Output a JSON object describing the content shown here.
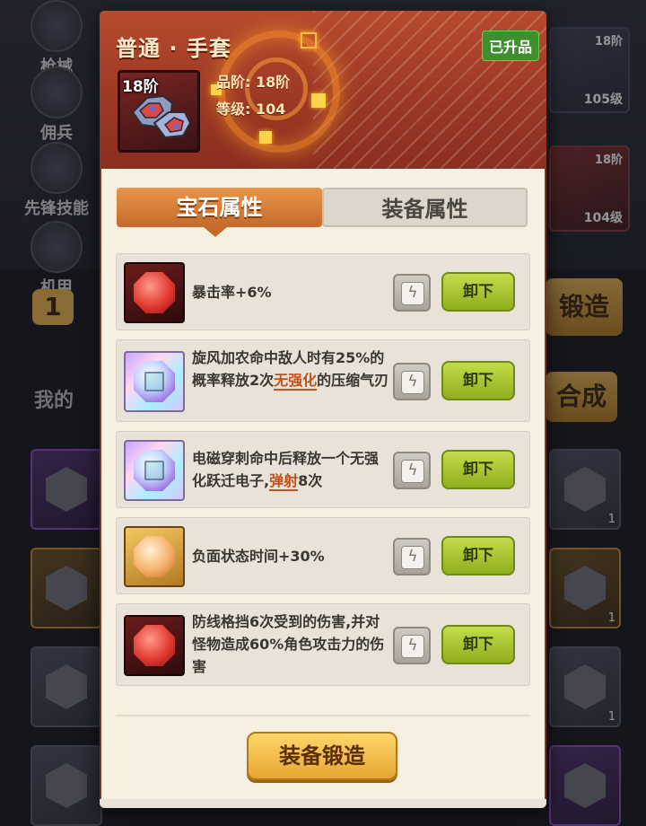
{
  "background": {
    "side_items": [
      "枪械",
      "佣兵",
      "先锋技能",
      "机甲"
    ],
    "card_levels": [
      "105级",
      "104级"
    ],
    "card_stars": [
      "18阶",
      "18阶"
    ],
    "counter": "1",
    "forge_button": "锻造",
    "combine_button": "合成",
    "my_label": "我的",
    "tile_counts": [
      "1",
      "1",
      "1"
    ]
  },
  "header": {
    "title": "普通 · 手套",
    "badge": "已升品",
    "item_level": "18阶",
    "quality": "品阶:  18阶",
    "level": "等级:  104"
  },
  "tabs": {
    "gem": "宝石属性",
    "equip": "装备属性",
    "active": "gem"
  },
  "gems": [
    {
      "color": "red",
      "text": "暴击率+6%",
      "action": "卸下"
    },
    {
      "color": "rainbow",
      "text_before": "旋风加农命中敌人时有25%的概率释放2次",
      "keyword": "无强化",
      "text_after": "的压缩气刃",
      "action": "卸下"
    },
    {
      "color": "rainbow",
      "text_before": "电磁穿刺命中后释放一个无强化跃迁电子,",
      "keyword": "弹射",
      "text_after": "8次",
      "action": "卸下"
    },
    {
      "color": "gold",
      "text": "负面状态时间+30%",
      "action": "卸下"
    },
    {
      "color": "red",
      "text": "防线格挡6次受到的伤害,并对怪物造成60%角色攻击力的伤害",
      "action": "卸下"
    }
  ],
  "footer": {
    "forge_label": "装备锻造"
  },
  "colors": {
    "header_red": "#a53c26",
    "tab_active": "#d97f38",
    "unload_green": "#a8c434",
    "forge_gold": "#f4c04e",
    "keyword_orange": "#c0531a"
  }
}
